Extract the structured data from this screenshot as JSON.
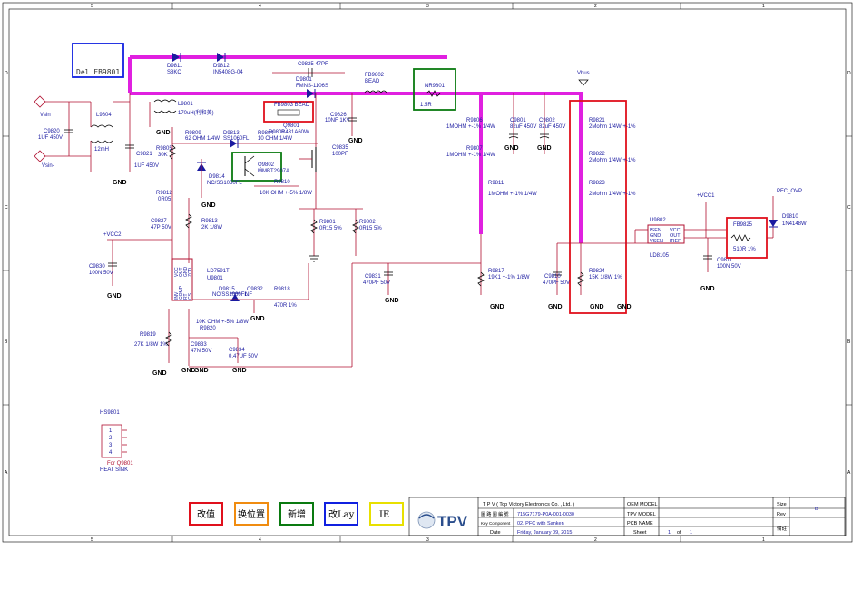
{
  "border": {
    "col_numbers": [
      "5",
      "4",
      "3",
      "2",
      "1"
    ],
    "row_letters": [
      "D",
      "C",
      "B",
      "A"
    ]
  },
  "annotation": {
    "del_note": "Del FB9801"
  },
  "labels": {
    "d9811": "D9811",
    "d9811_val": "S8KC",
    "d9812": "D9812",
    "d9812_val": "IN5408G-04",
    "c9825": "C9825  47PF",
    "d9801": "D9801",
    "d9801_val": "FMNS-1106S",
    "fb9802": "FB9802",
    "fb9802_val": "BEAD",
    "nr9801": "NR9801",
    "nr9801_val": "1.5R",
    "vbus": "Vbus",
    "fb9803": "FB9803   BEAD",
    "q9801": "Q9801",
    "r9808": "R9808",
    "r9808_val": "R431A60W",
    "c9826": "C9826",
    "c9826_val": "10NF 1KV",
    "r9806": "R9806",
    "r9806_val": "1MOHM +-1% 1/4W",
    "r9807": "R9807",
    "r9807_val": "1MOHM +-1% 1/4W",
    "r9811": "R9811",
    "r9811_val": "1MOHM +-1% 1/4W",
    "c9801": "C9801",
    "c9801_val": "82uF 450V",
    "c9802": "C9802",
    "c9802_val": "82uF 450V",
    "r9821": "R9821",
    "r9821_val": "2Mohm 1/4W +-1%",
    "r9822": "R9822",
    "r9822_val": "2Mohm 1/4W +-1%",
    "r9823": "R9823",
    "r9823_val": "2Mohm 1/4W +-1%",
    "vsin_p": "Vsin",
    "vsin_n": "Vsin-",
    "c9820": "C9820",
    "c9820_val": "1UF 450V",
    "l9804": "L9804",
    "l9804_val": "12mH",
    "l9801": "L9801",
    "l9801_val": "170uH(利和美)",
    "c9821": "C9821",
    "c9821_val": "1UF 450V",
    "r9805": "R9805",
    "r9805_val": "30K",
    "r9809": "R9809",
    "r9809_val": "62 OHM 1/4W",
    "d9813": "D9813",
    "d9813_val": "SS1060FL",
    "r9804": "R9804",
    "r9804_val": "10 OHM 1/4W",
    "q9802": "Q9802",
    "q9802_val": "MMBT2907A",
    "c9835": "C9835",
    "c9835_val": "100PF",
    "d9814": "D9814",
    "d9814_val": "NC/SS1060FL",
    "r9810": "R9810",
    "r9810_val": "10K OHM +-5% 1/8W",
    "r9812": "R9812",
    "r9812_val": "0R05",
    "c9827": "C9827",
    "c9827_val": "47P 50V",
    "r9813": "R9813",
    "r9813_val": "2K 1/8W",
    "r9801": "R9801",
    "r9801_val": "0R15 5%",
    "r9802": "R9802",
    "r9802_val": "0R15 5%",
    "vcc2": "+VCC2",
    "c9830": "C9830",
    "c9830_val": "100N 50V",
    "u9801_part": "LD7591T",
    "u9801_ref": "U9801",
    "u9801_pins": [
      "VCC",
      "OUT",
      "GND",
      "ZCD",
      "INV",
      "COMP",
      "RT",
      "CS"
    ],
    "d9815": "D9815",
    "d9815_val": "NC/SS1060FL",
    "c9832": "C9832",
    "c9832_val": "NF",
    "r9818": "R9818",
    "r9818_val": "470R 1%",
    "r9816_val": "10K OHM +-5% 1/8W",
    "r9820": "R9820",
    "r9819": "R9819",
    "r9819_val": "27K 1/8W 1%",
    "c9833": "C9833",
    "c9833_val": "47N 50V",
    "c9834": "C9834",
    "c9834_val": "0.47UF 50V",
    "c9831": "C9831",
    "c9831_val": "470PF 50V",
    "r9817": "R9817",
    "r9817_val": "19K1 +-1% 1/8W",
    "c9810": "C9810",
    "c9810_val": "470PF 50V",
    "r9824": "R9824",
    "r9824_val": "15K 1/8W 1%",
    "vcc1": "+VCC1",
    "u9802_ref": "U9802",
    "u9802_part": "LD8105",
    "u9802_pins": [
      "ISEN",
      "GND",
      "VSEN",
      "VCC",
      "OUT",
      "IREF"
    ],
    "c9811": "C9811",
    "c9811_val": "100N 50V",
    "pfc_ovp": "PFC_OVP",
    "fb9825": "FB9825",
    "fb9825_val": "510R 1%",
    "d9810": "D9810",
    "d9810_val": "1N4148W",
    "hs9801": "HS9801",
    "hs_pins": [
      "1",
      "2",
      "3",
      "4"
    ],
    "hs_for": "For Q9801",
    "hs_name": "HEAT SINK",
    "gnd": "GND"
  },
  "legend": [
    {
      "text": "改值",
      "color": "#e0101c"
    },
    {
      "text": "换位置",
      "color": "#f08c10"
    },
    {
      "text": "新增",
      "color": "#0a7a10"
    },
    {
      "text": "改Lay",
      "color": "#1020e0"
    },
    {
      "text": "IE",
      "color": "#e8e000"
    }
  ],
  "title_block": {
    "company": "T P V  ( Top   Victory   Electronics   Co. ,  Ltd. )",
    "logo": "TPV",
    "r1_label": "圖 路 圖 編 號",
    "r1_value": "715G7179-P0A-001-0030",
    "r2_label": "Key Component",
    "r2_value": "02. PFC with Sanken",
    "r3_label": "Date",
    "r3_value": "Friday, January 09, 2015",
    "oem_model": "OEM MODEL",
    "tpv_model": "TPV MODEL",
    "pcb_name": "PCB NAME",
    "sheet": "Sheet",
    "sheet_num": "1",
    "sheet_of": "of",
    "sheet_total": "1",
    "size": "Size",
    "size_val": "B",
    "rev": "Rev",
    "note": "備註"
  },
  "colors": {
    "wire": "#b01030",
    "text": "#1a1aa0",
    "highlight_power": "#e020e0",
    "box_red": "#e0101c",
    "box_green": "#0a7a10",
    "box_blue": "#1020e0"
  }
}
